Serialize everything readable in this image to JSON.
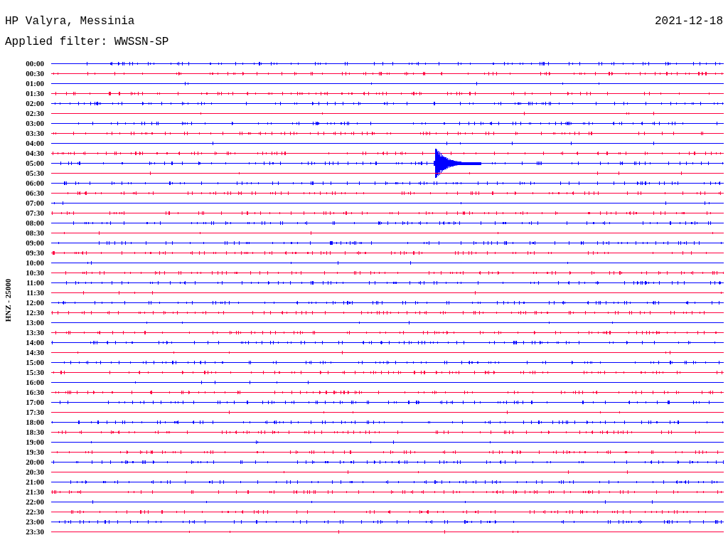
{
  "header": {
    "station": "HP Valyra, Messinia",
    "date": "2021-12-18",
    "filter": "Applied filter: WWSSN-SP"
  },
  "channel_label": "HNZ - 25000",
  "traces": [
    {
      "time": "00:00",
      "color": "#0000ff"
    },
    {
      "time": "00:30",
      "color": "#ff0040"
    },
    {
      "time": "01:00",
      "color": "#0000ff"
    },
    {
      "time": "01:30",
      "color": "#ff0040"
    },
    {
      "time": "02:00",
      "color": "#0000ff"
    },
    {
      "time": "02:30",
      "color": "#ff0040"
    },
    {
      "time": "03:00",
      "color": "#0000ff"
    },
    {
      "time": "03:30",
      "color": "#ff0040"
    },
    {
      "time": "04:00",
      "color": "#0000ff"
    },
    {
      "time": "04:30",
      "color": "#ff0040"
    },
    {
      "time": "05:00",
      "color": "#0000ff"
    },
    {
      "time": "05:30",
      "color": "#ff0040"
    },
    {
      "time": "06:00",
      "color": "#0000ff"
    },
    {
      "time": "06:30",
      "color": "#ff0040"
    },
    {
      "time": "07:00",
      "color": "#0000ff"
    },
    {
      "time": "07:30",
      "color": "#ff0040"
    },
    {
      "time": "08:00",
      "color": "#0000ff"
    },
    {
      "time": "08:30",
      "color": "#ff0040"
    },
    {
      "time": "09:00",
      "color": "#0000ff"
    },
    {
      "time": "09:30",
      "color": "#ff0040"
    },
    {
      "time": "10:00",
      "color": "#0000ff"
    },
    {
      "time": "10:30",
      "color": "#ff0040"
    },
    {
      "time": "11:00",
      "color": "#0000ff"
    },
    {
      "time": "11:30",
      "color": "#ff0040"
    },
    {
      "time": "12:00",
      "color": "#0000ff"
    },
    {
      "time": "12:30",
      "color": "#ff0040"
    },
    {
      "time": "13:00",
      "color": "#0000ff"
    },
    {
      "time": "13:30",
      "color": "#ff0040"
    },
    {
      "time": "14:00",
      "color": "#0000ff"
    },
    {
      "time": "14:30",
      "color": "#ff0040"
    },
    {
      "time": "15:00",
      "color": "#0000ff"
    },
    {
      "time": "15:30",
      "color": "#ff0040"
    },
    {
      "time": "16:00",
      "color": "#0000ff"
    },
    {
      "time": "16:30",
      "color": "#ff0040"
    },
    {
      "time": "17:00",
      "color": "#0000ff"
    },
    {
      "time": "17:30",
      "color": "#ff0040"
    },
    {
      "time": "18:00",
      "color": "#0000ff"
    },
    {
      "time": "18:30",
      "color": "#ff0040"
    },
    {
      "time": "19:00",
      "color": "#0000ff"
    },
    {
      "time": "19:30",
      "color": "#ff0040"
    },
    {
      "time": "20:00",
      "color": "#0000ff"
    },
    {
      "time": "20:30",
      "color": "#ff0040"
    },
    {
      "time": "21:00",
      "color": "#0000ff"
    },
    {
      "time": "21:30",
      "color": "#ff0040"
    },
    {
      "time": "22:00",
      "color": "#0000ff"
    },
    {
      "time": "22:30",
      "color": "#ff0040"
    },
    {
      "time": "23:00",
      "color": "#0000ff"
    },
    {
      "time": "23:30",
      "color": "#ff0040"
    }
  ]
}
